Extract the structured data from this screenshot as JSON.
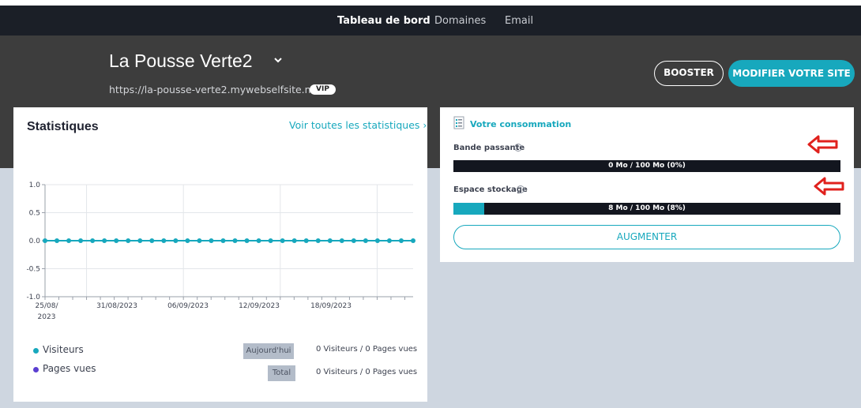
{
  "nav": {
    "items": [
      {
        "label": "Tableau de bord",
        "active": true
      },
      {
        "label": "Domaines",
        "active": false
      },
      {
        "label": "Email",
        "active": false
      }
    ]
  },
  "site": {
    "title": "La Pousse Verte2",
    "url": "https://la-pousse-verte2.mywebselfsite.net",
    "badge": "VIP"
  },
  "actions": {
    "booster_label": "BOOSTER",
    "modify_label": "MODIFIER VOTRE SITE"
  },
  "stats": {
    "title": "Statistiques",
    "link_label": "Voir toutes les statistiques ›",
    "legend": [
      {
        "label": "Visiteurs",
        "color": "#17a8bd"
      },
      {
        "label": "Pages vues",
        "color": "#5b3fd1"
      }
    ],
    "rows": [
      {
        "tag": "Aujourd'hui",
        "value": "0 Visiteurs / 0 Pages vues"
      },
      {
        "tag": "Total",
        "value": "0 Visiteurs / 0 Pages vues"
      }
    ]
  },
  "chart_data": {
    "type": "line",
    "ylim": [
      -1.0,
      1.0
    ],
    "y_ticks": [
      "1.0",
      "0.5",
      "0.0",
      "-0.5",
      "-1.0"
    ],
    "x_tick_labels": [
      {
        "line1": "25/08/",
        "line2": "2023"
      },
      {
        "line1": "31/08/2023",
        "line2": ""
      },
      {
        "line1": "06/09/2023",
        "line2": ""
      },
      {
        "line1": "12/09/2023",
        "line2": ""
      },
      {
        "line1": "18/09/2023",
        "line2": ""
      }
    ],
    "series": [
      {
        "color": "#17a8bd",
        "values": [
          0,
          0,
          0,
          0,
          0,
          0,
          0,
          0,
          0,
          0,
          0,
          0,
          0,
          0,
          0,
          0,
          0,
          0,
          0,
          0,
          0,
          0,
          0,
          0,
          0,
          0,
          0,
          0,
          0,
          0,
          0,
          0
        ]
      }
    ]
  },
  "consumption": {
    "title": "Votre consommation",
    "bandwidth": {
      "label": "Bande passante",
      "text": "0 Mo / 100 Mo (0%)",
      "percent": 0
    },
    "storage": {
      "label": "Espace stockage",
      "text": "8 Mo / 100 Mo (8%)",
      "percent": 8
    },
    "augment_label": "AUGMENTER"
  },
  "colors": {
    "accent": "#17a8bd",
    "arrow": "#e0211d"
  }
}
